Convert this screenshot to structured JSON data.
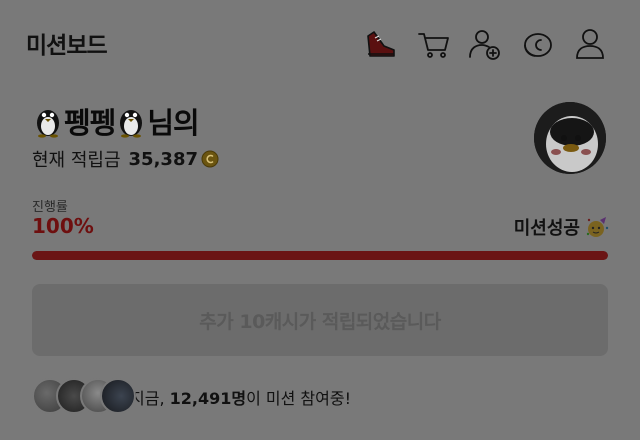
{
  "header": {
    "title": "미션보드",
    "icons": [
      "sneaker-icon",
      "cart-icon",
      "add-user-icon",
      "coin-icon",
      "profile-icon"
    ]
  },
  "user": {
    "name": "펭펭",
    "suffix": "님의",
    "points_label": "현재 적립금",
    "points_value": "35,387"
  },
  "progress": {
    "label": "진행률",
    "percent_text": "100%",
    "value": 1.0,
    "status": "미션성공"
  },
  "notice": {
    "text": "추가 10캐시가 적립되었습니다"
  },
  "participants": {
    "prefix": "지금, ",
    "count": "12,491명",
    "suffix": "이 미션 참여중!"
  },
  "colors": {
    "accent": "#6b1515",
    "background": "#797979"
  }
}
